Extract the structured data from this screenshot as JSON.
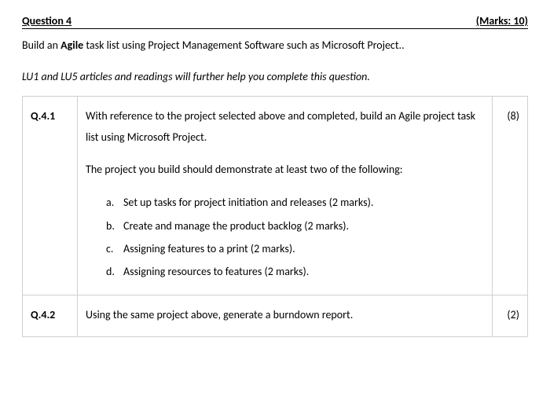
{
  "header": {
    "title": "Question 4",
    "marks": "(Marks: 10)"
  },
  "intro": {
    "pre": "Build an ",
    "bold": "Agile",
    "post": " task list using Project Management Software such as Microsoft Project.."
  },
  "hint": "LU1 and LU5 articles and readings will further help you complete this question.",
  "q41": {
    "num": "Q.4.1",
    "p1": "With reference to the project selected above and completed, build an Agile project task list using Microsoft Project.",
    "p2": "The project you build should demonstrate at least two of the following:",
    "items": {
      "a": {
        "lbl": "a.",
        "txt": "Set up tasks for project initiation and releases (2 marks)."
      },
      "b": {
        "lbl": "b.",
        "txt": "Create and manage the product backlog (2 marks)."
      },
      "c": {
        "lbl": "c.",
        "txt": "Assigning features to a print (2 marks)."
      },
      "d": {
        "lbl": "d.",
        "txt": "Assigning resources to features (2 marks)."
      }
    },
    "marks": "(8)"
  },
  "q42": {
    "num": "Q.4.2",
    "p1": "Using the same project above, generate a burndown report.",
    "marks": "(2)"
  }
}
